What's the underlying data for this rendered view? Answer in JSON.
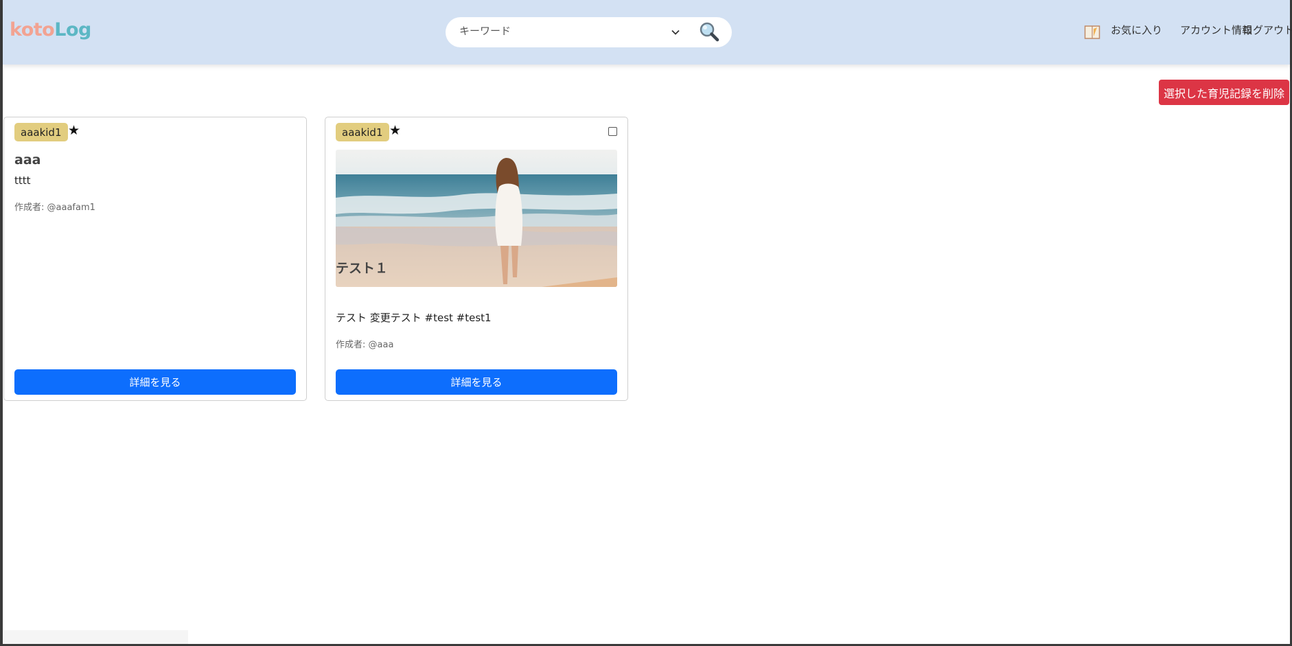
{
  "header": {
    "logo": {
      "part1": "koto",
      "part2": "Log"
    },
    "search": {
      "placeholder": "キーワード",
      "chevron_icon": "chevron-down-icon",
      "search_icon": "magnifier-icon"
    },
    "nav": {
      "book_icon": "notebook-icon",
      "favorites": "お気に入り",
      "account": "アカウント情報",
      "logout": "ログアウト"
    }
  },
  "actions": {
    "delete_selected": "選択した育児記録を削除"
  },
  "cards": [
    {
      "badge": "aaakid1",
      "star": "★",
      "title": "aaa",
      "body": "tttt",
      "author": "作成者: @aaafam1",
      "detail_button": "詳細を見る",
      "has_image": false,
      "has_checkbox": false
    },
    {
      "badge": "aaakid1",
      "star": "★",
      "title": "テスト１",
      "body": "テスト 変更テスト #test #test1",
      "author": "作成者: @aaa",
      "detail_button": "詳細を見る",
      "has_image": true,
      "image_subject": "woman in white dress walking on beach",
      "has_checkbox": true
    }
  ],
  "colors": {
    "header_bg": "#d3e1f3",
    "logo_pink": "#f2a392",
    "logo_teal": "#5cb7c4",
    "badge_bg": "#e2cd7f",
    "primary_button": "#0d6efd",
    "danger_button": "#dc3545"
  }
}
